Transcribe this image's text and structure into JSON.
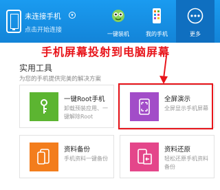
{
  "connection": {
    "title": "未连接手机",
    "subtitle": "点击开始连接"
  },
  "nav": [
    {
      "label": "一键装机",
      "icon": "robot-icon"
    },
    {
      "label": "我的手机",
      "icon": "phone-grid-icon"
    },
    {
      "label": "更多",
      "icon": "more-dots-icon",
      "active": true
    }
  ],
  "annotation": "手机屏幕投射到电脑屏幕",
  "section": {
    "title": "实用工具",
    "subtitle": "为您的手机提供完美的解决方案"
  },
  "tools": [
    {
      "title": "一键Root手机",
      "desc": "卸载预装应用、一键解除Root",
      "color": "#5cb531",
      "icon": "key-icon"
    },
    {
      "title": "全屏演示",
      "desc": "全屏显示手机屏幕",
      "color": "#a24dc8",
      "icon": "fullscreen-icon",
      "highlighted": true
    },
    {
      "title": "资料备份",
      "desc": "手机资料一键备份",
      "color": "#f37d1c",
      "icon": "backup-icon"
    },
    {
      "title": "资料还原",
      "desc": "轻松还原手机资料备份",
      "color": "#e4468a",
      "icon": "restore-icon"
    }
  ],
  "colors": {
    "header": "#1a9bf0",
    "nav_active": "#0f6fc0",
    "annotation": "#e8141a"
  }
}
